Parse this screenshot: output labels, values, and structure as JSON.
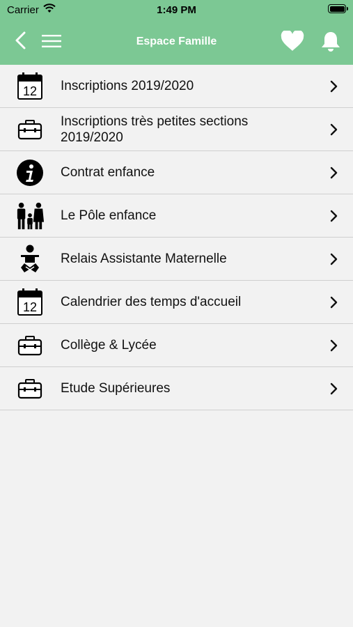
{
  "status_bar": {
    "carrier": "Carrier",
    "time": "1:49 PM"
  },
  "nav": {
    "title": "Espace Famille",
    "icons": {
      "back": "chevron-left-icon",
      "menu": "hamburger-menu-icon",
      "favorites": "heart-icon",
      "notifications": "bell-icon"
    }
  },
  "colors": {
    "header_bg": "#7cc894",
    "header_text": "#ffffff",
    "list_bg": "#f2f2f2",
    "divider": "#cfcfcf"
  },
  "menu_items": [
    {
      "label": "Inscriptions 2019/2020",
      "icon": "calendar-icon",
      "calendar_day": "12"
    },
    {
      "label": "Inscriptions très petites sections 2019/2020",
      "icon": "briefcase-icon"
    },
    {
      "label": "Contrat enfance",
      "icon": "info-icon"
    },
    {
      "label": "Le Pôle enfance",
      "icon": "family-icon"
    },
    {
      "label": "Relais Assistante Maternelle",
      "icon": "baby-icon"
    },
    {
      "label": "Calendrier des temps d'accueil",
      "icon": "calendar-icon",
      "calendar_day": "12"
    },
    {
      "label": "Collège & Lycée",
      "icon": "briefcase-icon"
    },
    {
      "label": "Etude Supérieures",
      "icon": "briefcase-icon"
    }
  ]
}
